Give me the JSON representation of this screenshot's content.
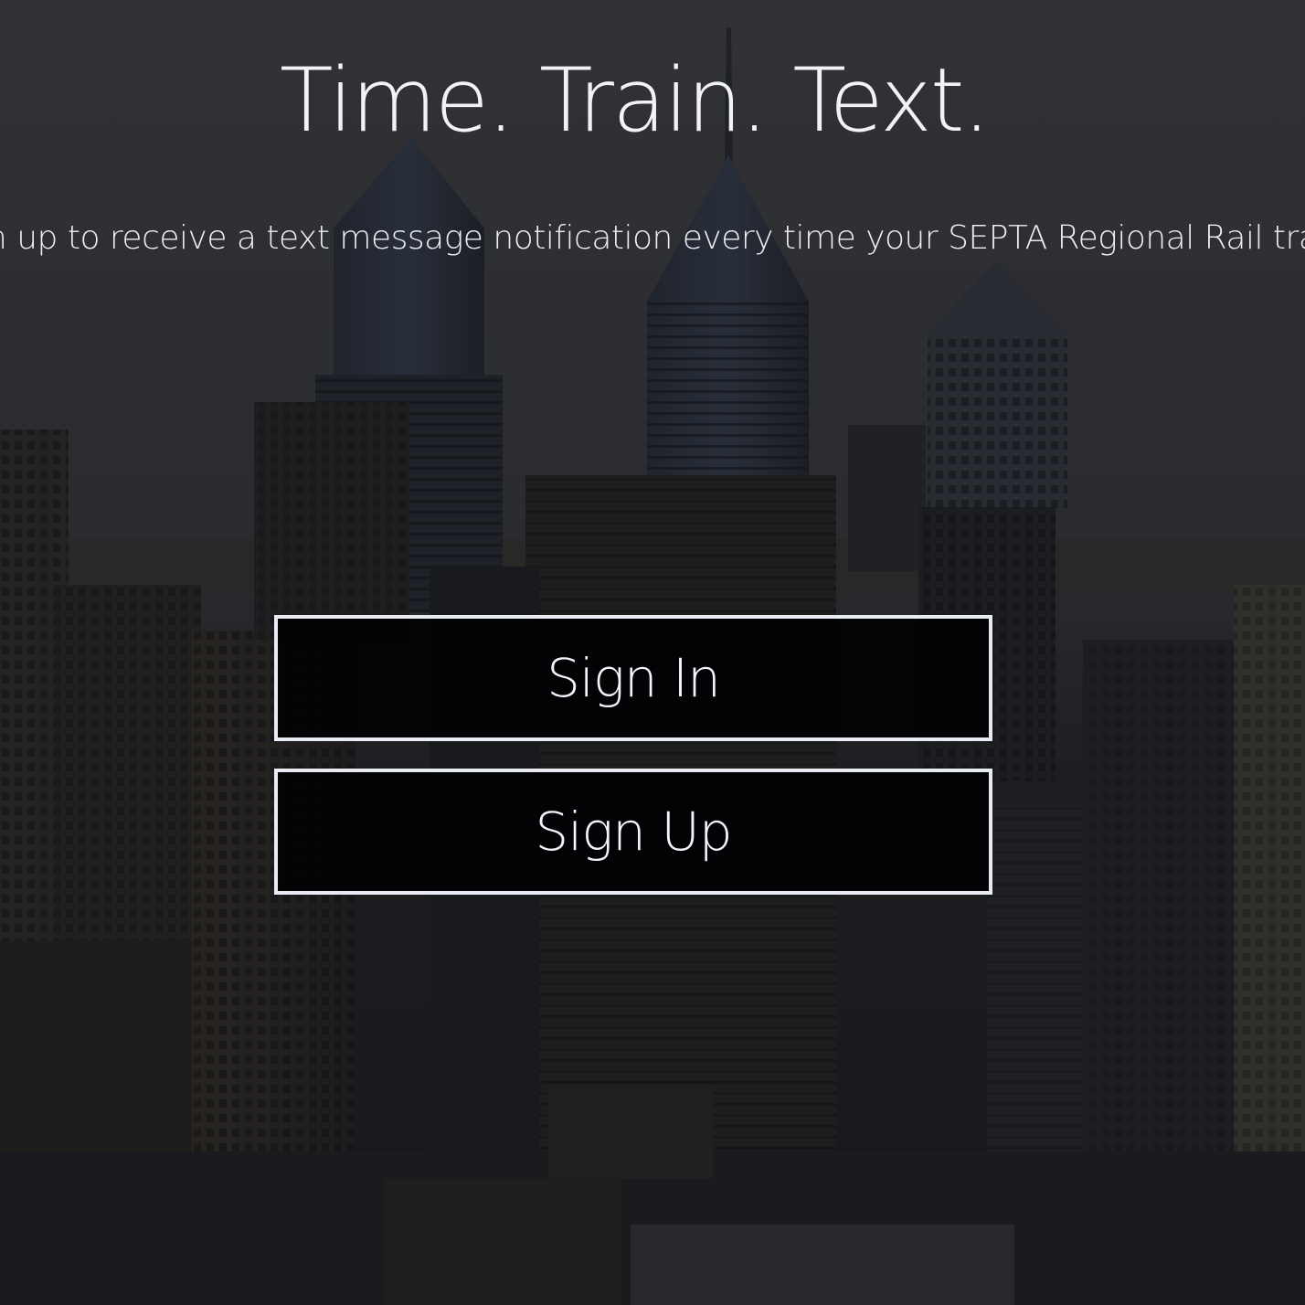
{
  "hero": {
    "title": "Time. Train. Text.",
    "tagline": "Sign up to receive a text message notification every time your SEPTA Regional Rail train is late."
  },
  "actions": {
    "sign_in_label": "Sign In",
    "sign_up_label": "Sign Up"
  },
  "colors": {
    "text": "#f2f3f8",
    "button_border": "#e8ebf4",
    "button_background": "#000002"
  },
  "background_image": "philadelphia-city-skyline-photo"
}
